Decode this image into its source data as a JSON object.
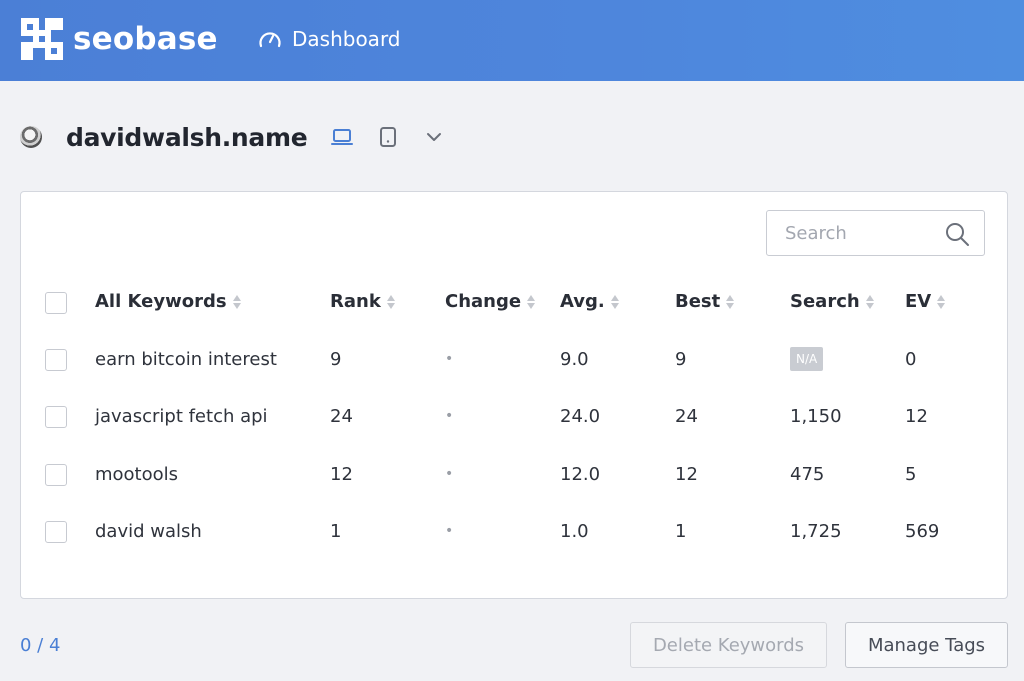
{
  "header": {
    "brand": "seobase",
    "nav_label": "Dashboard"
  },
  "site": {
    "domain": "davidwalsh.name",
    "icons": [
      "desktop-icon",
      "tablet-icon",
      "chevron-down-icon"
    ]
  },
  "search": {
    "placeholder": "Search"
  },
  "table": {
    "headers": {
      "keyword": "All Keywords",
      "rank": "Rank",
      "change": "Change",
      "avg": "Avg.",
      "best": "Best",
      "search": "Search",
      "ev": "EV"
    },
    "rows": [
      {
        "keyword": "earn bitcoin interest",
        "rank": "9",
        "change": "•",
        "avg": "9.0",
        "best": "9",
        "search": "N/A",
        "ev": "0"
      },
      {
        "keyword": "javascript fetch api",
        "rank": "24",
        "change": "•",
        "avg": "24.0",
        "best": "24",
        "search": "1,150",
        "ev": "12"
      },
      {
        "keyword": "mootools",
        "rank": "12",
        "change": "•",
        "avg": "12.0",
        "best": "12",
        "search": "475",
        "ev": "5"
      },
      {
        "keyword": "david walsh",
        "rank": "1",
        "change": "•",
        "avg": "1.0",
        "best": "1",
        "search": "1,725",
        "ev": "569"
      }
    ]
  },
  "footer": {
    "selection_count": "0 / 4",
    "delete_label": "Delete Keywords",
    "manage_tags_label": "Manage Tags"
  },
  "colors": {
    "header_bg": "#4e86dc",
    "accent": "#4a7fd4",
    "badge_bg": "#c9ccd2"
  }
}
